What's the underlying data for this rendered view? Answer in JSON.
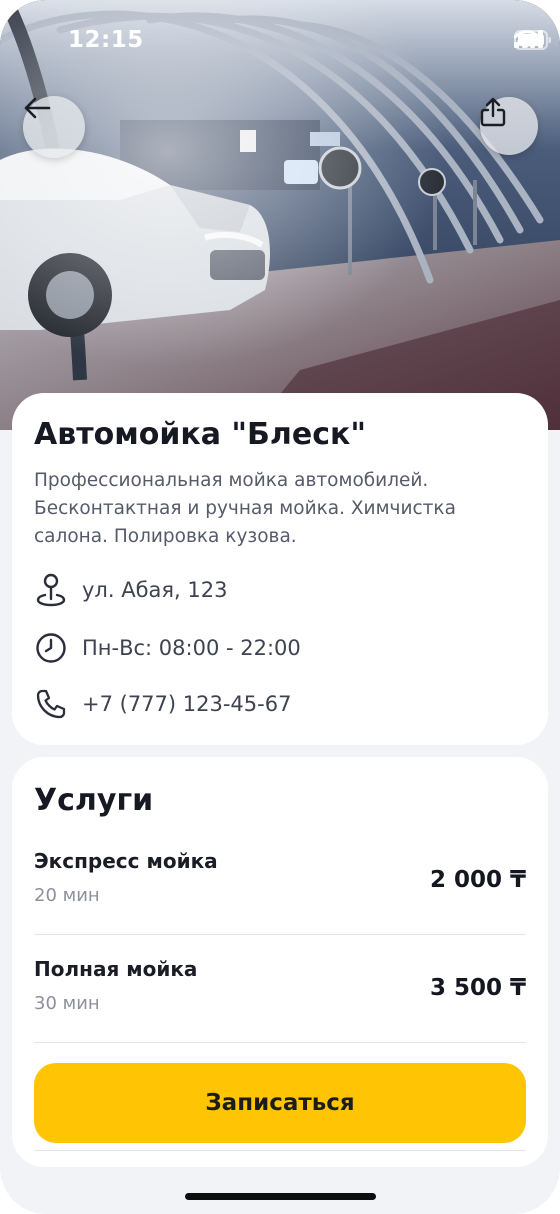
{
  "status_bar": {
    "time": "12:15"
  },
  "header": {
    "back_icon": "arrow-left-icon",
    "share_icon": "share-icon"
  },
  "business": {
    "name": "Автомойка \"Блеск\"",
    "description": "Профессиональная мойка автомобилей. Бесконтактная и ручная мойка. Химчистка салона. Полировка кузова.",
    "address": "ул. Абая, 123",
    "hours": "Пн-Вс: 08:00 - 22:00",
    "phone": "+7 (777) 123-45-67"
  },
  "services": {
    "title": "Услуги",
    "items": [
      {
        "name": "Экспресс мойка",
        "duration": "20 мин",
        "price": "2 000 ₸"
      },
      {
        "name": "Полная мойка",
        "duration": "30 мин",
        "price": "3 500 ₸"
      }
    ]
  },
  "cta": {
    "label": "Записаться"
  },
  "colors": {
    "accent": "#ffc505",
    "text": "#14171f",
    "muted": "#8c919c"
  }
}
